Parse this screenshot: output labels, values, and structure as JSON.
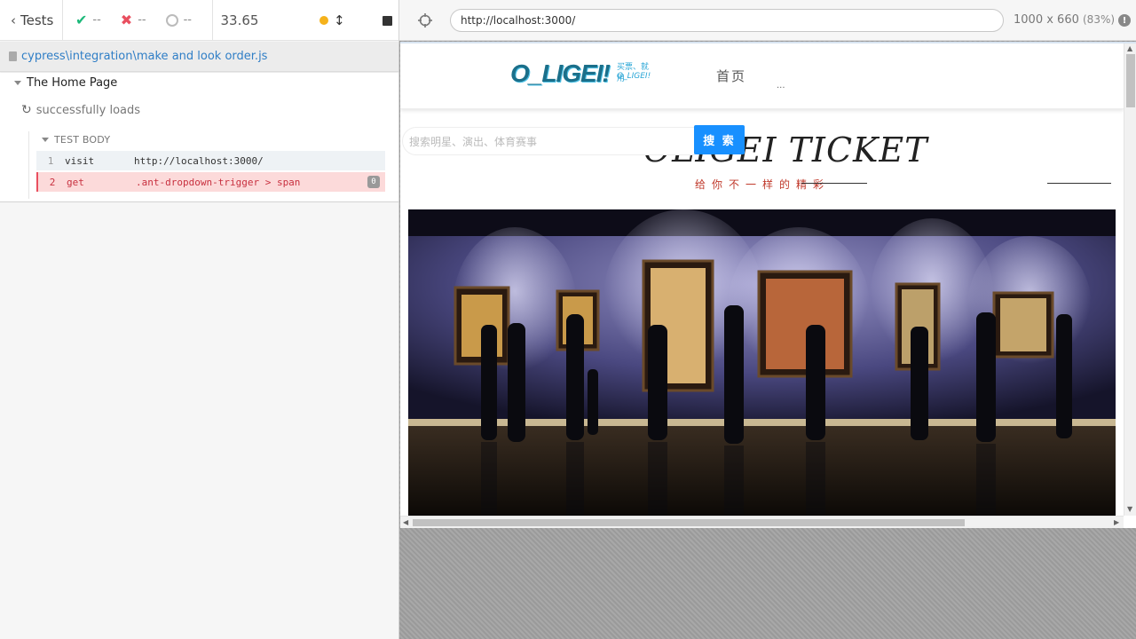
{
  "reporter": {
    "tests_label": "Tests",
    "stats": {
      "passed": "--",
      "failed": "--",
      "pending": "--"
    },
    "duration": "33.65",
    "spec_path": "cypress\\integration\\make and look order.js",
    "suite_title": "The Home Page",
    "test_title": "successfully loads",
    "body_label": "TEST BODY",
    "commands": [
      {
        "num": "1",
        "name": "visit",
        "arg": "http://localhost:3000/"
      },
      {
        "num": "2",
        "name": "get",
        "arg": ".ant-dropdown-trigger > span",
        "badge": "0"
      }
    ]
  },
  "runner": {
    "url": "http://localhost:3000/",
    "viewport": "1000 x 660",
    "scale": "(83%)"
  },
  "app": {
    "logo_text": "O_LIGEI!",
    "logo_sub1": "买票、就用",
    "logo_sub2": "O_LIGEI!",
    "nav_home": "首页",
    "nav_more": "...",
    "search_placeholder": "搜索明星、演出、体育赛事",
    "search_button": "搜 索",
    "title": "OLIGEI TICKET",
    "subtitle": "给你不一样的精彩"
  },
  "colors": {
    "pass": "#1db97a",
    "fail": "#e94f5f",
    "link": "#2f7ec6",
    "search_button": "#1890ff",
    "subtitle": "#c0392b"
  }
}
